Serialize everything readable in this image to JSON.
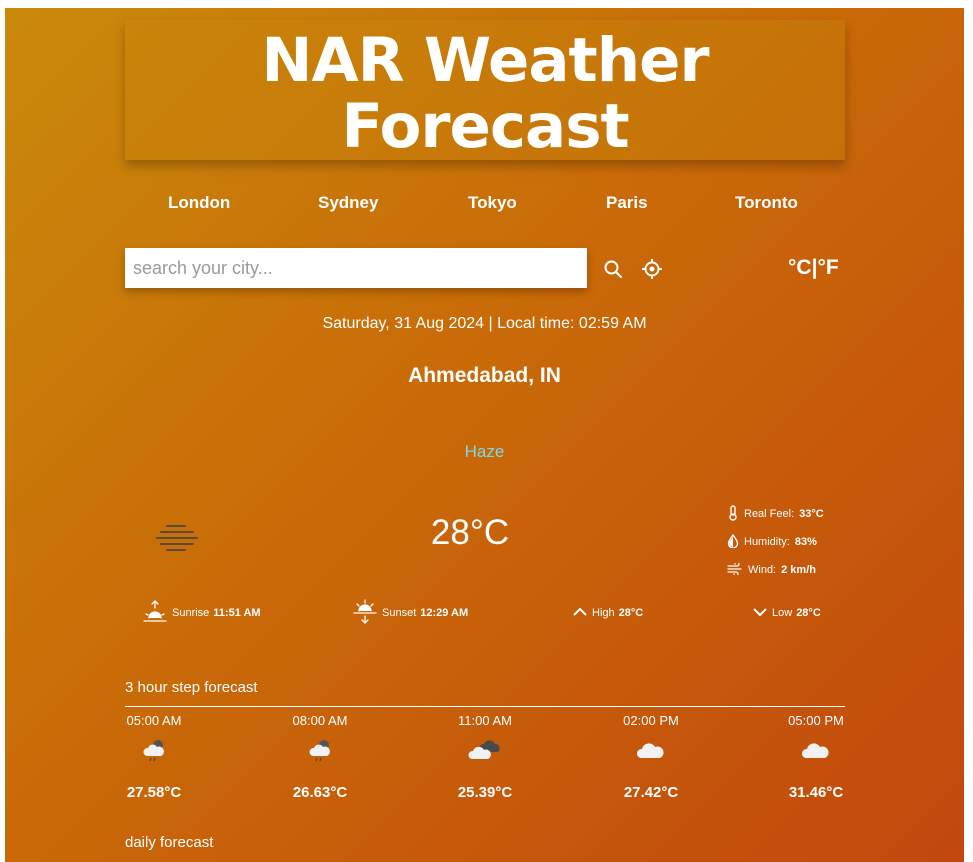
{
  "header": {
    "title_line1": "NAR Weather",
    "title_line2": "Forecast"
  },
  "cities": [
    "London",
    "Sydney",
    "Tokyo",
    "Paris",
    "Toronto"
  ],
  "search": {
    "placeholder": "search your city...",
    "value": ""
  },
  "units": {
    "celsius": "°C",
    "separator": "|",
    "fahrenheit": "°F"
  },
  "current": {
    "datetime": "Saturday, 31 Aug 2024 | Local time: 02:59 AM",
    "location": "Ahmedabad, IN",
    "condition": "Haze",
    "temperature": "28°C",
    "condition_icon": "haze-icon",
    "details": {
      "real_feel_label": "Real Feel:",
      "real_feel_value": "33°C",
      "humidity_label": "Humidity:",
      "humidity_value": "83%",
      "wind_label": "Wind:",
      "wind_value": "2 km/h"
    },
    "sun": {
      "sunrise_label": "Sunrise",
      "sunrise_value": "11:51 AM",
      "sunset_label": "Sunset",
      "sunset_value": "12:29 AM",
      "high_label": "High",
      "high_value": "28°C",
      "low_label": "Low",
      "low_value": "28°C"
    }
  },
  "hourly": {
    "title": "3 hour step forecast",
    "items": [
      {
        "time": "05:00 AM",
        "icon": "cloud-rain-night-icon",
        "temp": "27.58°C"
      },
      {
        "time": "08:00 AM",
        "icon": "cloud-rain-night-icon",
        "temp": "26.63°C"
      },
      {
        "time": "11:00 AM",
        "icon": "broken-clouds-icon",
        "temp": "25.39°C"
      },
      {
        "time": "02:00 PM",
        "icon": "cloud-icon",
        "temp": "27.42°C"
      },
      {
        "time": "05:00 PM",
        "icon": "cloud-icon",
        "temp": "31.46°C"
      }
    ]
  },
  "daily": {
    "title": "daily forecast"
  },
  "colors": {
    "accent_condition": "#7fd9e6",
    "gradient_start": "#c98a0a",
    "gradient_end": "#c2480e"
  }
}
